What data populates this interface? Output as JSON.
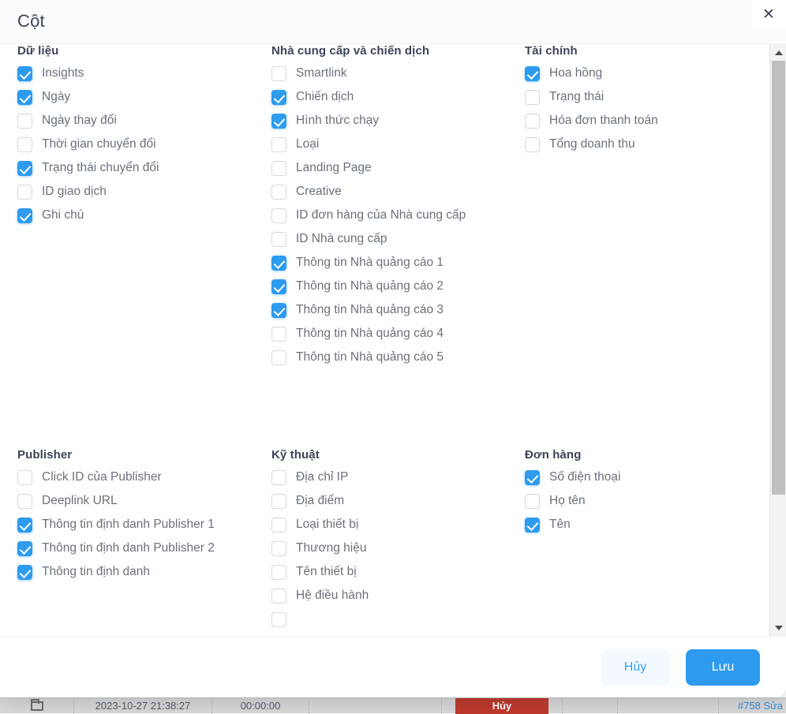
{
  "dialog": {
    "title": "Cột",
    "close_icon": "close-icon"
  },
  "footer": {
    "cancel_label": "Hủy",
    "save_label": "Lưu"
  },
  "scrollbar": {
    "up_icon": "chevron-up-icon",
    "down_icon": "chevron-down-icon"
  },
  "colors": {
    "accent": "#2e9bef",
    "cancel_bg": "#f3f9fe",
    "title_text": "#3c4458",
    "option_text": "#6b717c",
    "scrollbar_thumb": "#bfbfbf",
    "status_chip": "#c0392b",
    "link": "#3e8ed0"
  },
  "groups": [
    {
      "id": "du-lieu",
      "title": "Dữ liệu",
      "options": [
        {
          "label": "Insights",
          "checked": true
        },
        {
          "label": "Ngày",
          "checked": true
        },
        {
          "label": "Ngày thay đổi",
          "checked": false
        },
        {
          "label": "Thời gian chuyển đổi",
          "checked": false
        },
        {
          "label": "Trạng thái chuyển đổi",
          "checked": true
        },
        {
          "label": "ID giao dịch",
          "checked": false
        },
        {
          "label": "Ghi chú",
          "checked": true
        }
      ]
    },
    {
      "id": "nha-cung-cap-va-chien-dich",
      "title": "Nhà cung cấp và chiến dịch",
      "options": [
        {
          "label": "Smartlink",
          "checked": false
        },
        {
          "label": "Chiến dịch",
          "checked": true
        },
        {
          "label": "Hình thức chạy",
          "checked": true
        },
        {
          "label": "Loại",
          "checked": false
        },
        {
          "label": "Landing Page",
          "checked": false
        },
        {
          "label": "Creative",
          "checked": false
        },
        {
          "label": "ID đơn hàng của Nhà cung cấp",
          "checked": false
        },
        {
          "label": "ID Nhà cung cấp",
          "checked": false
        },
        {
          "label": "Thông tin Nhà quảng cáo 1",
          "checked": true
        },
        {
          "label": "Thông tin Nhà quảng cáo 2",
          "checked": true
        },
        {
          "label": "Thông tin Nhà quảng cáo 3",
          "checked": true
        },
        {
          "label": "Thông tin Nhà quảng cáo 4",
          "checked": false
        },
        {
          "label": "Thông tin Nhà quảng cáo 5",
          "checked": false
        }
      ]
    },
    {
      "id": "tai-chinh",
      "title": "Tài chính",
      "options": [
        {
          "label": "Hoa hồng",
          "checked": true
        },
        {
          "label": "Trạng thái",
          "checked": false
        },
        {
          "label": "Hóa đơn thanh toán",
          "checked": false
        },
        {
          "label": "Tổng doanh thu",
          "checked": false
        }
      ]
    },
    {
      "id": "publisher",
      "title": "Publisher",
      "options": [
        {
          "label": "Click ID của Publisher",
          "checked": false
        },
        {
          "label": "Deeplink URL",
          "checked": false
        },
        {
          "label": "Thông tin định danh Publisher 1",
          "checked": true
        },
        {
          "label": "Thông tin định danh Publisher 2",
          "checked": true
        },
        {
          "label": "Thông tin định danh",
          "checked": true
        }
      ]
    },
    {
      "id": "ky-thuat",
      "title": "Kỹ thuật",
      "options": [
        {
          "label": "Địa chỉ IP",
          "checked": false
        },
        {
          "label": "Địa điểm",
          "checked": false
        },
        {
          "label": "Loại thiết bị",
          "checked": false
        },
        {
          "label": "Thương hiệu",
          "checked": false
        },
        {
          "label": "Tên thiết bị",
          "checked": false
        },
        {
          "label": "Hệ điều hành",
          "checked": false
        },
        {
          "label": "",
          "checked": false
        }
      ]
    },
    {
      "id": "don-hang",
      "title": "Đơn hàng",
      "options": [
        {
          "label": "Số điện thoại",
          "checked": true
        },
        {
          "label": "Họ tên",
          "checked": false
        },
        {
          "label": "Tên",
          "checked": true
        }
      ]
    }
  ],
  "background_row": {
    "folder_icon": "folder-icon",
    "datetime": "2023-10-27 21:38:27",
    "duration": "00:00:00",
    "status": "Hủy",
    "record_link": "#758 Sửa"
  }
}
